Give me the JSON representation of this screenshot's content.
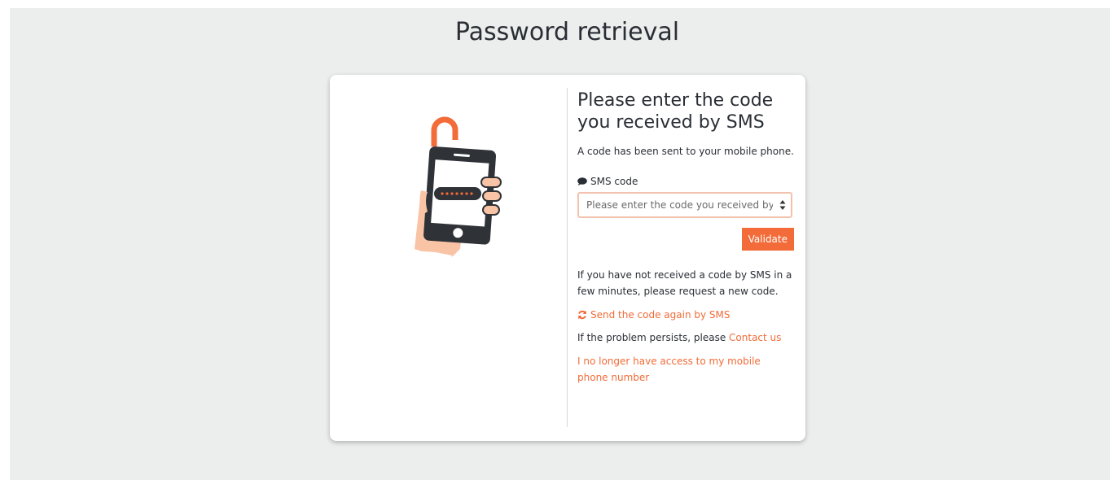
{
  "page": {
    "title": "Password retrieval"
  },
  "form": {
    "heading": "Please enter the code you received by SMS",
    "info": "A code has been sent to your mobile phone.",
    "field_label": "SMS code",
    "input_placeholder": "Please enter the code you received by SMS",
    "input_value": "",
    "validate_label": "Validate"
  },
  "help": {
    "notice": "If you have not received a code by SMS in a few minutes, please request a new code.",
    "resend_label": "Send the code again by SMS",
    "persist_text": "If the problem persists, please ",
    "contact_label": "Contact us",
    "no_access_label": "I no longer have access to my mobile phone number"
  },
  "icons": {
    "illustration": "phone-unlock-illustration",
    "field": "comment-icon",
    "resend": "refresh-icon"
  },
  "colors": {
    "accent": "#f26b38",
    "text": "#2a2e35",
    "background": "#eceeed",
    "phone": "#2f3237",
    "skin": "#f9c3a6"
  }
}
